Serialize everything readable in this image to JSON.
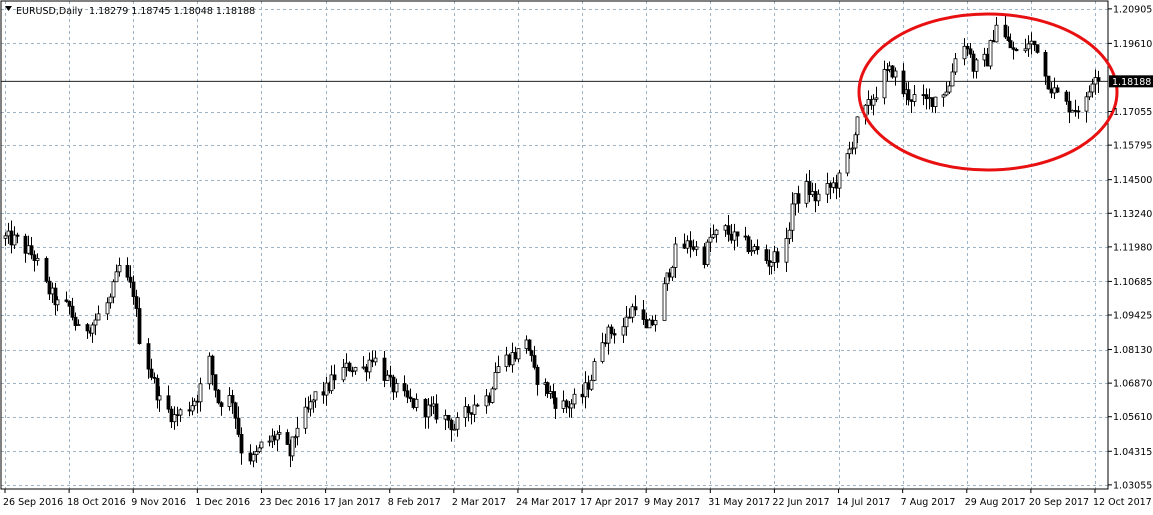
{
  "chart_data": {
    "type": "candlestick",
    "title": "EURUSD,Daily",
    "ohlc_label": "1.18279 1.18745 1.18048 1.18188",
    "current_price": 1.18188,
    "current_price_label": "1.18188",
    "timeframe": "Daily",
    "symbol": "EURUSD",
    "ylim": [
      1.029,
      1.212
    ],
    "y_ticks": [
      {
        "value": 1.20905,
        "label": "1.20905"
      },
      {
        "value": 1.1961,
        "label": "1.19610"
      },
      {
        "value": 1.17055,
        "label": "1.17055"
      },
      {
        "value": 1.15795,
        "label": "1.15795"
      },
      {
        "value": 1.145,
        "label": "1.14500"
      },
      {
        "value": 1.1324,
        "label": "1.13240"
      },
      {
        "value": 1.1198,
        "label": "1.11980"
      },
      {
        "value": 1.10685,
        "label": "1.10685"
      },
      {
        "value": 1.09425,
        "label": "1.09425"
      },
      {
        "value": 1.0813,
        "label": "1.08130"
      },
      {
        "value": 1.0687,
        "label": "1.06870"
      },
      {
        "value": 1.0561,
        "label": "1.05610"
      },
      {
        "value": 1.04315,
        "label": "1.04315"
      },
      {
        "value": 1.03055,
        "label": "1.03055"
      }
    ],
    "x_ticks": [
      "26 Sep 2016",
      "18 Oct 2016",
      "9 Nov 2016",
      "1 Dec 2016",
      "23 Dec 2016",
      "17 Jan 2017",
      "8 Feb 2017",
      "2 Mar 2017",
      "24 Mar 2017",
      "17 Apr 2017",
      "9 May 2017",
      "31 May 2017",
      "22 Jun 2017",
      "14 Jul 2017",
      "7 Aug 2017",
      "29 Aug 2017",
      "20 Sep 2017",
      "12 Oct 2017"
    ],
    "close_path": [
      {
        "date": "26 Sep 2016",
        "close": 1.123
      },
      {
        "date": "30 Sep 2016",
        "close": 1.122
      },
      {
        "date": "6 Oct 2016",
        "close": 1.116
      },
      {
        "date": "10 Oct 2016",
        "close": 1.105
      },
      {
        "date": "14 Oct 2016",
        "close": 1.098
      },
      {
        "date": "18 Oct 2016",
        "close": 1.097
      },
      {
        "date": "21 Oct 2016",
        "close": 1.088
      },
      {
        "date": "26 Oct 2016",
        "close": 1.091
      },
      {
        "date": "1 Nov 2016",
        "close": 1.1
      },
      {
        "date": "4 Nov 2016",
        "close": 1.112
      },
      {
        "date": "9 Nov 2016",
        "close": 1.103
      },
      {
        "date": "11 Nov 2016",
        "close": 1.086
      },
      {
        "date": "15 Nov 2016",
        "close": 1.072
      },
      {
        "date": "18 Nov 2016",
        "close": 1.062
      },
      {
        "date": "23 Nov 2016",
        "close": 1.056
      },
      {
        "date": "28 Nov 2016",
        "close": 1.06
      },
      {
        "date": "1 Dec 2016",
        "close": 1.064
      },
      {
        "date": "5 Dec 2016",
        "close": 1.077
      },
      {
        "date": "8 Dec 2016",
        "close": 1.062
      },
      {
        "date": "13 Dec 2016",
        "close": 1.063
      },
      {
        "date": "16 Dec 2016",
        "close": 1.044
      },
      {
        "date": "20 Dec 2016",
        "close": 1.04
      },
      {
        "date": "23 Dec 2016",
        "close": 1.045
      },
      {
        "date": "29 Dec 2016",
        "close": 1.049
      },
      {
        "date": "3 Jan 2017",
        "close": 1.042
      },
      {
        "date": "6 Jan 2017",
        "close": 1.053
      },
      {
        "date": "10 Jan 2017",
        "close": 1.058
      },
      {
        "date": "13 Jan 2017",
        "close": 1.064
      },
      {
        "date": "17 Jan 2017",
        "close": 1.066
      },
      {
        "date": "20 Jan 2017",
        "close": 1.071
      },
      {
        "date": "25 Jan 2017",
        "close": 1.075
      },
      {
        "date": "30 Jan 2017",
        "close": 1.074
      },
      {
        "date": "2 Feb 2017",
        "close": 1.079
      },
      {
        "date": "6 Feb 2017",
        "close": 1.072
      },
      {
        "date": "8 Feb 2017",
        "close": 1.068
      },
      {
        "date": "13 Feb 2017",
        "close": 1.063
      },
      {
        "date": "16 Feb 2017",
        "close": 1.061
      },
      {
        "date": "20 Feb 2017",
        "close": 1.059
      },
      {
        "date": "23 Feb 2017",
        "close": 1.058
      },
      {
        "date": "28 Feb 2017",
        "close": 1.055
      },
      {
        "date": "2 Mar 2017",
        "close": 1.052
      },
      {
        "date": "6 Mar 2017",
        "close": 1.057
      },
      {
        "date": "9 Mar 2017",
        "close": 1.061
      },
      {
        "date": "14 Mar 2017",
        "close": 1.064
      },
      {
        "date": "16 Mar 2017",
        "close": 1.074
      },
      {
        "date": "20 Mar 2017",
        "close": 1.078
      },
      {
        "date": "24 Mar 2017",
        "close": 1.08
      },
      {
        "date": "27 Mar 2017",
        "close": 1.086
      },
      {
        "date": "30 Mar 2017",
        "close": 1.072
      },
      {
        "date": "4 Apr 2017",
        "close": 1.066
      },
      {
        "date": "7 Apr 2017",
        "close": 1.062
      },
      {
        "date": "11 Apr 2017",
        "close": 1.06
      },
      {
        "date": "13 Apr 2017",
        "close": 1.061
      },
      {
        "date": "17 Apr 2017",
        "close": 1.064
      },
      {
        "date": "20 Apr 2017",
        "close": 1.071
      },
      {
        "date": "24 Apr 2017",
        "close": 1.086
      },
      {
        "date": "27 Apr 2017",
        "close": 1.088
      },
      {
        "date": "1 May 2017",
        "close": 1.09
      },
      {
        "date": "5 May 2017",
        "close": 1.099
      },
      {
        "date": "9 May 2017",
        "close": 1.088
      },
      {
        "date": "12 May 2017",
        "close": 1.093
      },
      {
        "date": "16 May 2017",
        "close": 1.108
      },
      {
        "date": "19 May 2017",
        "close": 1.118
      },
      {
        "date": "24 May 2017",
        "close": 1.121
      },
      {
        "date": "29 May 2017",
        "close": 1.116
      },
      {
        "date": "31 May 2017",
        "close": 1.123
      },
      {
        "date": "5 Jun 2017",
        "close": 1.126
      },
      {
        "date": "8 Jun 2017",
        "close": 1.123
      },
      {
        "date": "13 Jun 2017",
        "close": 1.12
      },
      {
        "date": "16 Jun 2017",
        "close": 1.118
      },
      {
        "date": "20 Jun 2017",
        "close": 1.114
      },
      {
        "date": "22 Jun 2017",
        "close": 1.116
      },
      {
        "date": "26 Jun 2017",
        "close": 1.12
      },
      {
        "date": "28 Jun 2017",
        "close": 1.136
      },
      {
        "date": "3 Jul 2017",
        "close": 1.142
      },
      {
        "date": "6 Jul 2017",
        "close": 1.138
      },
      {
        "date": "11 Jul 2017",
        "close": 1.142
      },
      {
        "date": "14 Jul 2017",
        "close": 1.145
      },
      {
        "date": "18 Jul 2017",
        "close": 1.156
      },
      {
        "date": "21 Jul 2017",
        "close": 1.166
      },
      {
        "date": "26 Jul 2017",
        "close": 1.174
      },
      {
        "date": "31 Jul 2017",
        "close": 1.184
      },
      {
        "date": "3 Aug 2017",
        "close": 1.186
      },
      {
        "date": "7 Aug 2017",
        "close": 1.178
      },
      {
        "date": "10 Aug 2017",
        "close": 1.176
      },
      {
        "date": "15 Aug 2017",
        "close": 1.174
      },
      {
        "date": "18 Aug 2017",
        "close": 1.176
      },
      {
        "date": "23 Aug 2017",
        "close": 1.18
      },
      {
        "date": "25 Aug 2017",
        "close": 1.192
      },
      {
        "date": "29 Aug 2017",
        "close": 1.196
      },
      {
        "date": "31 Aug 2017",
        "close": 1.187
      },
      {
        "date": "5 Sep 2017",
        "close": 1.19
      },
      {
        "date": "8 Sep 2017",
        "close": 1.204
      },
      {
        "date": "12 Sep 2017",
        "close": 1.196
      },
      {
        "date": "15 Sep 2017",
        "close": 1.192
      },
      {
        "date": "18 Sep 2017",
        "close": 1.195
      },
      {
        "date": "20 Sep 2017",
        "close": 1.196
      },
      {
        "date": "22 Sep 2017",
        "close": 1.195
      },
      {
        "date": "25 Sep 2017",
        "close": 1.184
      },
      {
        "date": "28 Sep 2017",
        "close": 1.178
      },
      {
        "date": "2 Oct 2017",
        "close": 1.173
      },
      {
        "date": "5 Oct 2017",
        "close": 1.172
      },
      {
        "date": "9 Oct 2017",
        "close": 1.174
      },
      {
        "date": "11 Oct 2017",
        "close": 1.183
      },
      {
        "date": "12 Oct 2017",
        "close": 1.186
      },
      {
        "date": "13 Oct 2017",
        "close": 1.1819
      }
    ],
    "annotation": {
      "type": "ellipse",
      "color": "#e81010",
      "encloses": "29 Jul 2017 – 13 Oct 2017, 1.170 – 1.205"
    },
    "grid": true,
    "colors": {
      "candles": "#000000",
      "grid": "#a0b4c8",
      "background": "#ffffff",
      "annotation": "#e81010",
      "price_box": "#000000"
    }
  }
}
